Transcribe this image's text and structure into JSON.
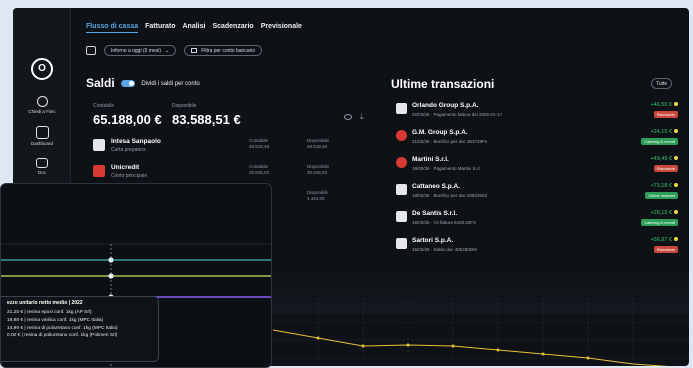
{
  "tabs": [
    {
      "label": "Flusso di cassa",
      "active": true
    },
    {
      "label": "Fatturato",
      "active": false
    },
    {
      "label": "Analisi",
      "active": false
    },
    {
      "label": "Scadenzario",
      "active": false
    },
    {
      "label": "Previsionale",
      "active": false
    }
  ],
  "filters": {
    "period": "Inforno a oggi (6 mesi)",
    "period_chevron": "⌄",
    "bank_filter": "Filtra per conto bancario"
  },
  "sidebar": {
    "logo": "O",
    "items": [
      {
        "label": "Chiedi a Fiinc"
      },
      {
        "label": "Dashboard"
      },
      {
        "label": "Doc"
      }
    ]
  },
  "saldi": {
    "title": "Saldi",
    "toggle_label": "Dividi i saldi per conto",
    "contabile_label": "Contabile",
    "disponibile_label": "Disponibile",
    "contabile_value": "65.188,00 €",
    "disponibile_value": "83.588,51 €",
    "banks": [
      {
        "name": "Intesa Sanpaolo",
        "sub": "Carta prepaters",
        "c1_label": "Contabile",
        "c1_value": "48.519,48",
        "c2_label": "Disponibile",
        "c2_value": "48.519,48"
      },
      {
        "name": "Unicredit",
        "sub": "Conto principale",
        "c1_label": "Contabile",
        "c1_value": "30.645,03",
        "c2_label": "Disponibile",
        "c2_value": "30.645,03"
      },
      {
        "name": "",
        "sub": "",
        "c1_label": "",
        "c1_value": "",
        "c2_label": "Disponibili",
        "c2_value": "4.424,00"
      }
    ]
  },
  "transactions": {
    "title": "Ultime transazioni",
    "all_button": "Tutte",
    "items": [
      {
        "name": "Orlando Group S.p.A.",
        "desc": "02/03/26 · Pagamento fattura del 2026-01-17",
        "amount": "+46,50 €",
        "badge": "Ristorante",
        "badge_color": "red",
        "icon": "square"
      },
      {
        "name": "G.M. Group S.p.A.",
        "desc": "21/02/26 · Bonifico per doc 353729Fe",
        "amount": "+24,15 €",
        "badge": "Catering & eventi",
        "badge_color": "green",
        "icon": "ban"
      },
      {
        "name": "Martini S.r.l.",
        "desc": "19/02/26 · Pagamento Martini S.r.l.",
        "amount": "+49,49 €",
        "badge": "Ristorante",
        "badge_color": "red",
        "icon": "ban"
      },
      {
        "name": "Cattaneo S.p.A.",
        "desc": "18/02/26 · Bonifico per doc 5082382Z",
        "amount": "+73,18 €",
        "badge": "Clienti ristorant",
        "badge_color": "green",
        "icon": "square"
      },
      {
        "name": "De Santis S.r.l.",
        "desc": "15/02/26 · Vs fattura 9428.33FX",
        "amount": "+28,19 €",
        "badge": "Catering & eventi",
        "badge_color": "green",
        "icon": "square"
      },
      {
        "name": "Sartori S.p.A.",
        "desc": "15/02/26 · Saldo doc 405480DM",
        "amount": "+56,97 €",
        "badge": "Ristorante",
        "badge_color": "red",
        "icon": "square"
      }
    ]
  },
  "tooltip": {
    "title": "ezzo unitario netto medio  | 2022",
    "rows": [
      {
        "text": "21,25 € | resina epoxi conf. 1kg (AP Srl)",
        "color": "#3fb7b0"
      },
      {
        "text": "19,98 € | resina vinilica conf. 1kg (MPC Italia)",
        "color": "#cfe05a"
      },
      {
        "text": "14,99 € | resina di poliuretano conf. 1kg (MPC Italia)",
        "color": "#8a5cf0"
      },
      {
        "text": "0,00 € | resina di poliuretano conf. 1kg (Polimeri Srl)",
        "color": "#f0c03a"
      }
    ]
  },
  "colors": {
    "accent": "#5aa6e6",
    "positive": "#3cc46c",
    "teal_line": "#3fb7b0",
    "lime_line": "#cfe05a",
    "purple_line": "#8a5cf0",
    "yellow_line": "#e6c23a"
  }
}
